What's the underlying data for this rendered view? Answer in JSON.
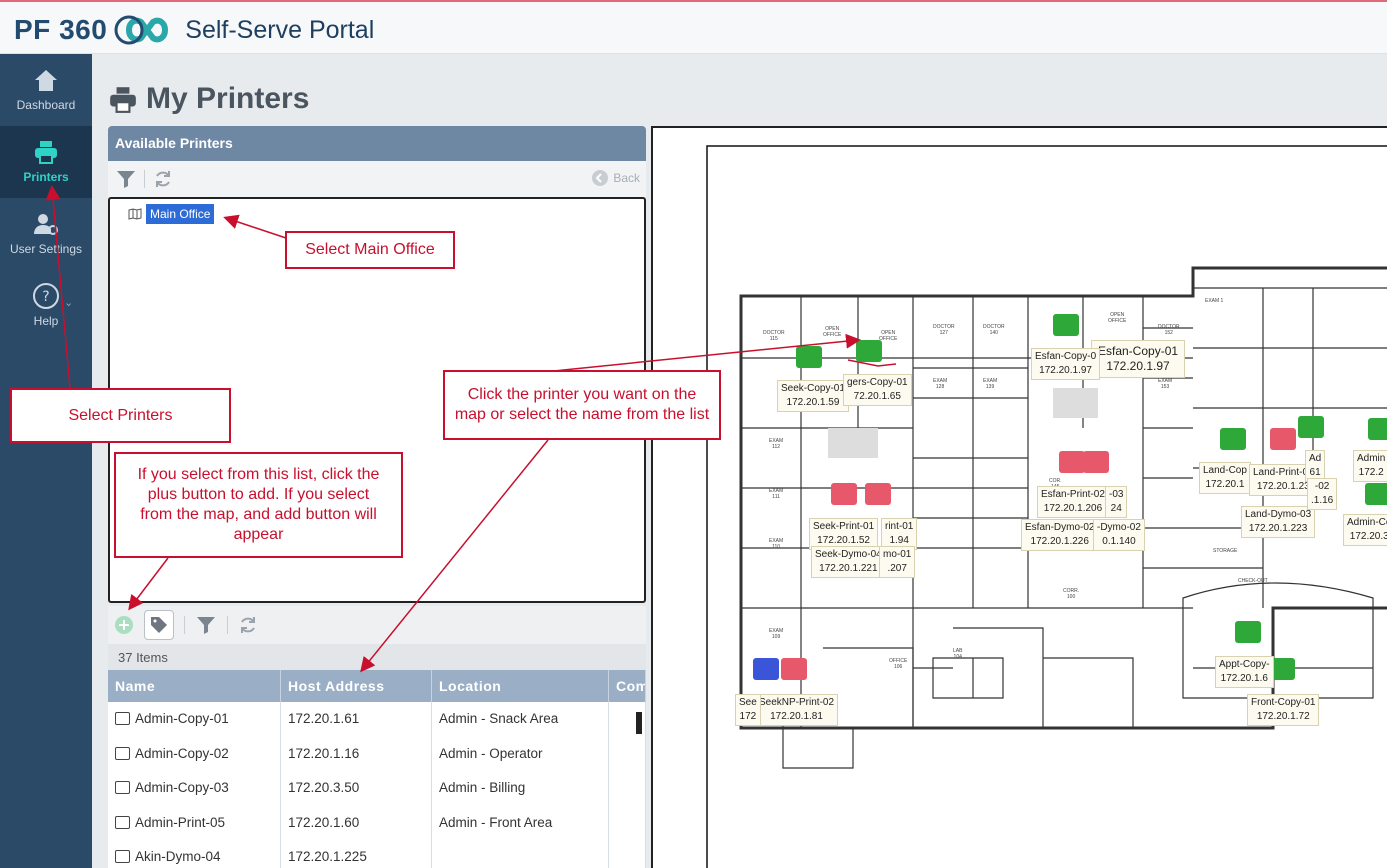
{
  "header": {
    "brand_pf": "PF",
    "brand_num": "360",
    "title": "Self-Serve Portal"
  },
  "sidebar": {
    "items": [
      {
        "label": "Dashboard",
        "icon": "home-icon"
      },
      {
        "label": "Printers",
        "icon": "printer-icon"
      },
      {
        "label": "User Settings",
        "icon": "user-gear-icon"
      },
      {
        "label": "Help",
        "icon": "help-icon"
      }
    ]
  },
  "page": {
    "title": "My Printers"
  },
  "available": {
    "header": "Available Printers",
    "back_label": "Back",
    "tree_item": "Main Office"
  },
  "list": {
    "count": "37 Items",
    "columns": [
      "Name",
      "Host Address",
      "Location",
      "Com"
    ],
    "rows": [
      {
        "name": "Admin-Copy-01",
        "host": "172.20.1.61",
        "location": "Admin - Snack Area"
      },
      {
        "name": "Admin-Copy-02",
        "host": "172.20.1.16",
        "location": "Admin - Operator"
      },
      {
        "name": "Admin-Copy-03",
        "host": "172.20.3.50",
        "location": "Admin - Billing"
      },
      {
        "name": "Admin-Print-05",
        "host": "172.20.1.60",
        "location": "Admin - Front Area"
      },
      {
        "name": "Akin-Dymo-04",
        "host": "172.20.1.225",
        "location": ""
      }
    ]
  },
  "callouts": {
    "main_office": "Select Main Office",
    "printers": "Select Printers",
    "map": "Click the printer you want on the map or select the name from the list",
    "plus": "If you select from this list, click the plus button to add. If you select from the map, and add button will appear"
  },
  "map": {
    "labels": [
      {
        "name": "Esfan-Copy-01",
        "ip": "172.20.1.97"
      },
      {
        "name": "Seek-Copy-01",
        "ip": "172.20.1.59"
      },
      {
        "name": "gers-Copy-01",
        "ip": "72.20.1.65"
      },
      {
        "name": "Esfan-Copy-0",
        "ip": "172.20.1.97"
      },
      {
        "name": "Land-Cop",
        "ip": "172.20.1"
      },
      {
        "name": "Land-Print-01",
        "ip": "172.20.1.23"
      },
      {
        "name": "Land-Dymo-03",
        "ip": "172.20.1.223"
      },
      {
        "name": "Esfan-Print-02",
        "ip": "172.20.1.206"
      },
      {
        "name": "Esfan-Dymo-02",
        "ip": "172.20.1.226"
      },
      {
        "name": "Seek-Print-01",
        "ip": "172.20.1.52"
      },
      {
        "name": "Seek-Dymo-04",
        "ip": "172.20.1.221"
      },
      {
        "name": "SeekNP-Print-02",
        "ip": "172.20.1.81"
      },
      {
        "name": "Appt-Copy-",
        "ip": "172.20.1.6"
      },
      {
        "name": "Front-Copy-01",
        "ip": "172.20.1.72"
      },
      {
        "name": "Admin-Co",
        "ip": "172.20.3"
      },
      {
        "name": "Admin",
        "ip": "172.2"
      },
      {
        "name": "Ad",
        "ip": "61"
      },
      {
        "name": "-02",
        "ip": ".1.16"
      },
      {
        "name": "rint-01",
        "ip": "1.94"
      },
      {
        "name": "mo-01",
        "ip": ".207"
      },
      {
        "name": "-03",
        "ip": "24"
      },
      {
        "name": "-Dymo-02",
        "ip": "0.1.140"
      },
      {
        "name": "See",
        "ip": "172"
      }
    ]
  },
  "colors": {
    "sidebar": "#2a4a68",
    "sidebar_active": "#1d3650",
    "accent": "#2fd3c6",
    "panel_header": "#6e88a4",
    "grid_header": "#9aafc6",
    "callout": "#c8102e",
    "printer_green": "#2fa83a",
    "printer_red": "#e8586b",
    "printer_blue": "#3a55d8"
  }
}
